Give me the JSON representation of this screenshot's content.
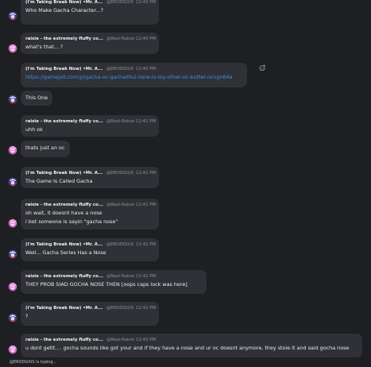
{
  "users": {
    "a": {
      "name": "(I'm Taking Break Now) •Mr. A...",
      "handle": "@ERODGIUS"
    },
    "b": {
      "name": "raisie - the extremely fluffy co...",
      "handle": "@Real-Raisie"
    }
  },
  "messages": [
    {
      "user": "a",
      "time": "12:40 PM",
      "lines": [
        "Who Make Gacha Character...?"
      ]
    },
    {
      "user": "b",
      "time": "12:40 PM",
      "lines": [
        "what's that... ?"
      ]
    },
    {
      "user": "a",
      "time": "12:40 PM",
      "lines": [
        "https://gamejolt.com/p/gacha-oc-gachalife2-here-is-my-other-oc-butter-ncvgn64a"
      ],
      "link": true
    },
    {
      "user": "a",
      "time": "",
      "lines": [
        "This One"
      ],
      "continuation": true
    },
    {
      "user": "b",
      "time": "12:41 PM",
      "lines": [
        "uhh ok"
      ]
    },
    {
      "user": "b",
      "time": "",
      "lines": [
        "thats just an oc"
      ],
      "continuation": true
    },
    {
      "user": "a",
      "time": "12:41 PM",
      "lines": [
        "The Game Is Called Gacha"
      ]
    },
    {
      "user": "b",
      "time": "12:41 PM",
      "lines": [
        "oh wait, it doesnt have a nose",
        "i bet someone is sayin \"gacha nose\""
      ]
    },
    {
      "user": "a",
      "time": "12:42 PM",
      "lines": [
        "Well... Gacha Series Has a Nose"
      ]
    },
    {
      "user": "b",
      "time": "12:42 PM",
      "lines": [
        "THEY PROB SIAD GOCHA NOSE THEN [oops caps lock was here]"
      ]
    },
    {
      "user": "a",
      "time": "12:42 PM",
      "lines": [
        "?"
      ]
    },
    {
      "user": "b",
      "time": "12:43 PM",
      "lines": [
        "u dont getit.... gocha sounds like got your and if they have a nose and ur oc doesnt anymore, they stole it and said gocha  nose"
      ]
    }
  ],
  "typing_indicator": "@ERODGIUS is typing...",
  "icons": {
    "reaction": "add-reaction-icon"
  },
  "colors": {
    "background": "#1e1f22",
    "bubble": "#2f3136",
    "link": "#3d8ff0",
    "avatar_a": "#3b3f9e",
    "avatar_b": "#d56bd0"
  }
}
